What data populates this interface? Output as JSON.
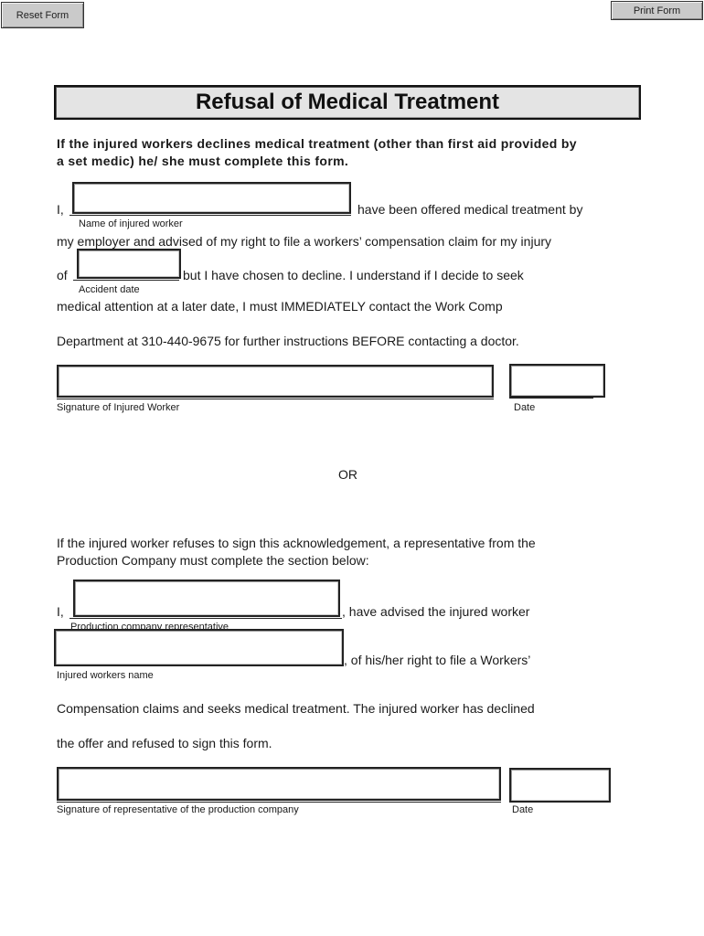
{
  "toolbar": {
    "reset_label": "Reset Form",
    "print_label": "Print Form"
  },
  "document": {
    "title": "Refusal of Medical Treatment",
    "intro_line1": "If the injured workers declines medical treatment (other than first aid provided by",
    "intro_line2": "a set medic) he/ she must complete this form.",
    "section1": {
      "prefix_i": "I,",
      "after_name": "have been offered medical treatment by",
      "name_label": "Name of injured worker",
      "line2": "my employer and advised of my right to file a workers’ compensation claim for my injury",
      "prefix_of": "of",
      "after_date": "but I have chosen to decline.  I understand if I decide to seek",
      "accident_date_label": "Accident date",
      "line4": "medical attention at a later date, I must IMMEDIATELY contact the Work Comp",
      "line5": "Department at 310-440-9675 for further instructions BEFORE contacting a doctor.",
      "signature_label": "Signature of Injured Worker",
      "date_label": "Date"
    },
    "or_text": "OR",
    "section2": {
      "intro_line1": "If the injured worker refuses to sign this acknowledgement, a representative from the",
      "intro_line2": "Production Company must complete the section below:",
      "prefix_i": "I,",
      "after_rep": ", have advised the injured worker",
      "rep_label": "Production company representative",
      "after_worker": ", of his/her right to file a Workers’",
      "worker_label": "Injured workers name",
      "line3": "Compensation claims and seeks medical treatment.  The injured worker has declined",
      "line4": "the offer and refused to sign this form.",
      "signature_label": "Signature of representative of the production company",
      "date_label": "Date"
    }
  },
  "fields": {
    "injured_worker_name": "",
    "accident_date": "",
    "injured_worker_signature": "",
    "injured_worker_signature_date": "",
    "representative_name": "",
    "injured_worker_name_2": "",
    "representative_signature": "",
    "representative_signature_date": ""
  }
}
